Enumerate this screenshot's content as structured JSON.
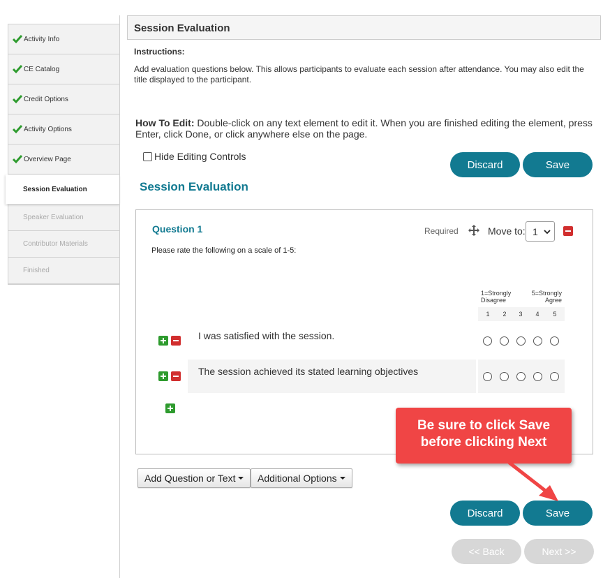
{
  "sidebar": {
    "items": [
      {
        "label": "Activity Info",
        "state": "done"
      },
      {
        "label": "CE Catalog",
        "state": "done"
      },
      {
        "label": "Credit Options",
        "state": "done"
      },
      {
        "label": "Activity Options",
        "state": "done"
      },
      {
        "label": "Overview Page",
        "state": "done"
      },
      {
        "label": "Session Evaluation",
        "state": "active"
      },
      {
        "label": "Speaker Evaluation",
        "state": "disabled"
      },
      {
        "label": "Contributor Materials",
        "state": "disabled"
      },
      {
        "label": "Finished",
        "state": "disabled"
      }
    ]
  },
  "header": {
    "title": "Session Evaluation"
  },
  "instructions": {
    "title": "Instructions:",
    "text": "Add evaluation questions below. This allows participants to evaluate each session after attendance. You may also edit the title displayed to the participant."
  },
  "how_to_edit": {
    "label": "How To Edit:",
    "text": " Double-click on any text element to edit it. When you are finished editing the element, press Enter, click Done, or click anywhere else on the page."
  },
  "hide_editing_controls": {
    "label": "Hide Editing Controls",
    "checked": false
  },
  "buttons": {
    "discard": "Discard",
    "save": "Save",
    "back": "<< Back",
    "next": "Next >>"
  },
  "section_title": "Session Evaluation",
  "question": {
    "title": "Question 1",
    "required_label": "Required",
    "move_to_label": "Move to:",
    "move_to_value": "1",
    "description": "Please rate the following on a scale of 1-5:",
    "scale": {
      "low_label_1": "1=Strongly",
      "low_label_2": "Disagree",
      "high_label_1": "5=Strongly",
      "high_label_2": "Agree",
      "points": [
        "1",
        "2",
        "3",
        "4",
        "5"
      ]
    },
    "statements": [
      "I was satisfied with the session.",
      "The session achieved its stated learning objectives"
    ]
  },
  "toolbar": {
    "add_question": "Add Question or Text",
    "additional_options": "Additional Options"
  },
  "callout": {
    "line1": "Be sure to click Save",
    "line2": "before clicking Next"
  },
  "colors": {
    "accent": "#127a91",
    "callout": "#f04545",
    "check": "#2e9b2e",
    "remove": "#d12e2e"
  }
}
